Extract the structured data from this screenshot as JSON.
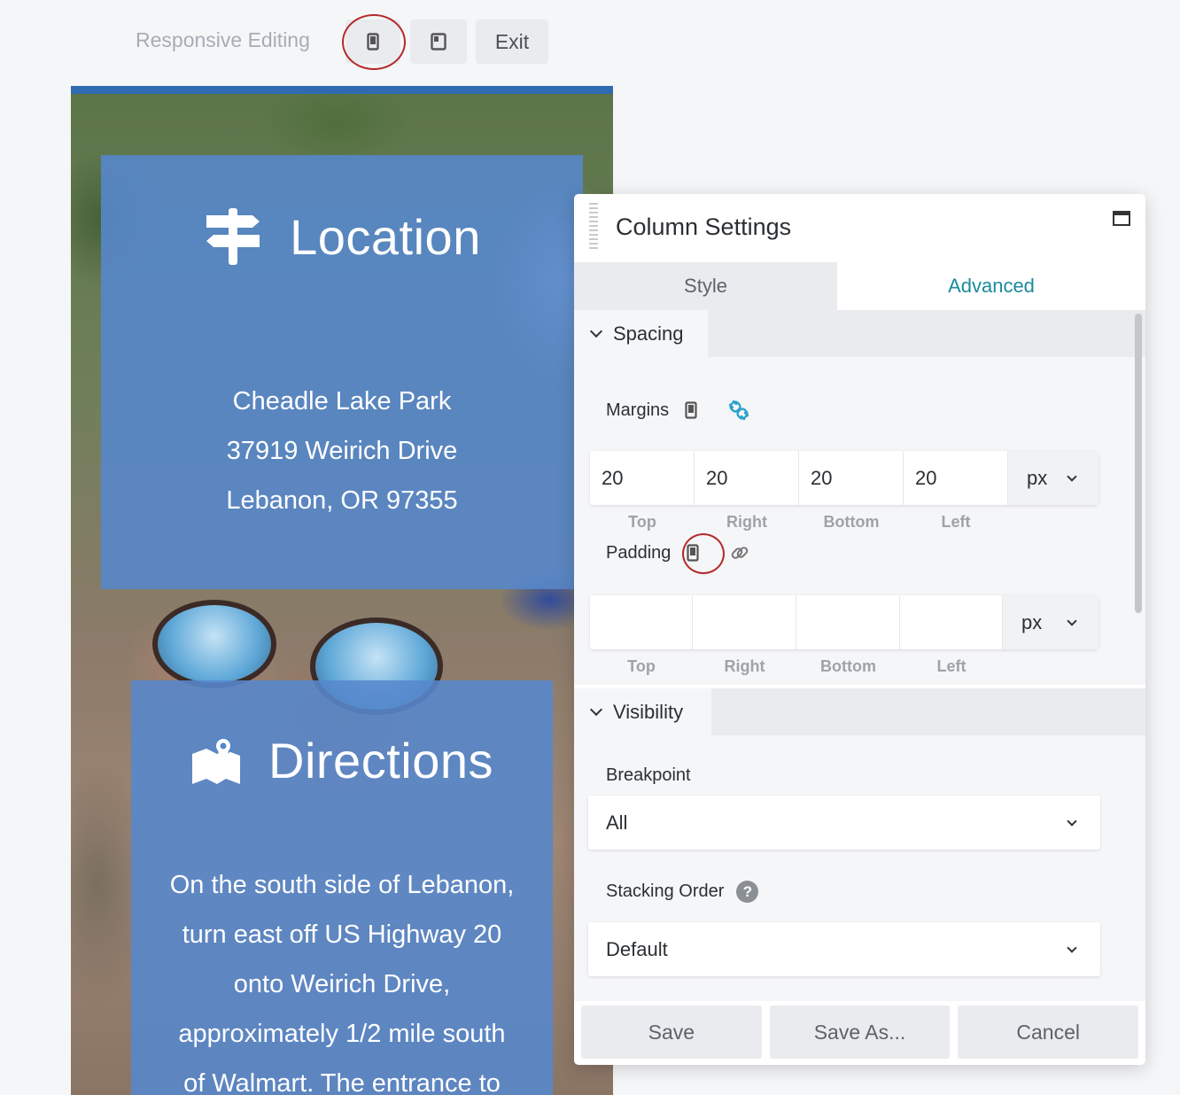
{
  "toolbar": {
    "responsive_label": "Responsive Editing",
    "exit_label": "Exit"
  },
  "preview": {
    "location": {
      "title": "Location",
      "lines": [
        "Cheadle Lake Park",
        "37919 Weirich Drive",
        "Lebanon, OR 97355"
      ]
    },
    "directions": {
      "title": "Directions",
      "lines": [
        "On the south side of Lebanon,",
        "turn east off US Highway 20",
        "onto Weirich Drive,",
        "approximately 1/2 mile south",
        "of Walmart. The entrance to"
      ]
    }
  },
  "panel": {
    "title": "Column Settings",
    "tabs": {
      "style": "Style",
      "advanced": "Advanced"
    },
    "active_tab": "Advanced",
    "spacing": {
      "heading": "Spacing",
      "margins": {
        "label": "Margins",
        "values": {
          "top": "20",
          "right": "20",
          "bottom": "20",
          "left": "20"
        },
        "unit": "px"
      },
      "padding": {
        "label": "Padding",
        "values": {
          "top": "",
          "right": "",
          "bottom": "",
          "left": ""
        },
        "unit": "px"
      },
      "captions": {
        "top": "Top",
        "right": "Right",
        "bottom": "Bottom",
        "left": "Left"
      }
    },
    "visibility": {
      "heading": "Visibility",
      "breakpoint_label": "Breakpoint",
      "breakpoint_value": "All",
      "stacking_label": "Stacking Order",
      "stacking_value": "Default",
      "help_glyph": "?"
    },
    "footer": {
      "save": "Save",
      "save_as": "Save As...",
      "cancel": "Cancel"
    }
  },
  "colors": {
    "accent": "#1a8b9c",
    "card_blue": "#5687cd",
    "highlight_circle": "#b42a2a",
    "link_icon_active": "#2aa3c9"
  },
  "icons": [
    "mobile-icon",
    "tablet-icon",
    "signpost-icon",
    "map-pin-icon",
    "link-icon",
    "maximize-icon",
    "chevron-down-icon",
    "help-icon"
  ]
}
